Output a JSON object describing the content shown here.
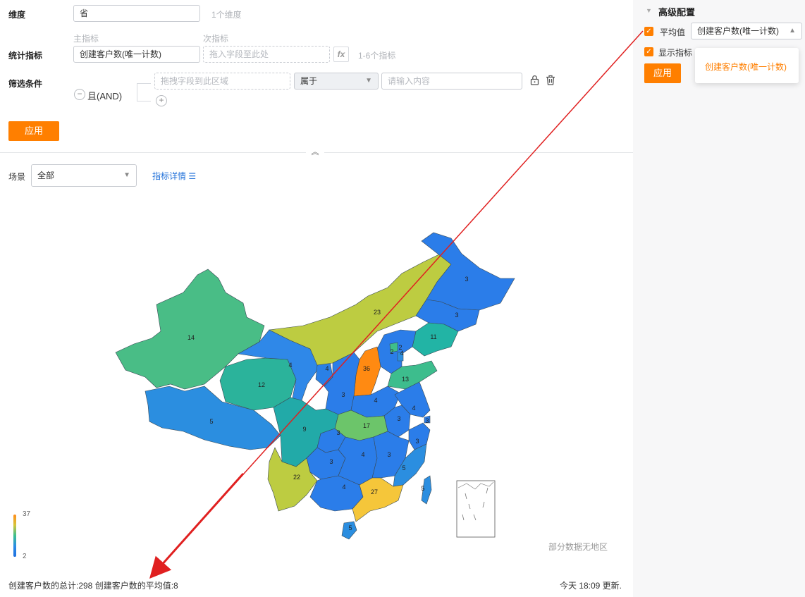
{
  "form": {
    "dimension_label": "维度",
    "dimension_value": "省",
    "dimension_hint": "1个维度",
    "main_metric_caption": "主指标",
    "secondary_metric_caption": "次指标",
    "metric_label": "统计指标",
    "main_metric_value": "创建客户数(唯一计数)",
    "secondary_metric_placeholder": "拖入字段至此处",
    "fx_label": "fx",
    "metric_hint": "1-6个指标",
    "filter_label": "筛选条件",
    "filter_drag_placeholder": "拖拽字段到此区域",
    "filter_operator": "属于",
    "filter_value_placeholder": "请输入内容",
    "and_label": "且(AND)",
    "apply_label": "应用"
  },
  "scene": {
    "label": "场景",
    "value": "全部",
    "detail_link": "指标详情"
  },
  "legend": {
    "max": "37",
    "min": "2"
  },
  "map_labels": [
    {
      "name": "xinjiang",
      "value": "14"
    },
    {
      "name": "tibet",
      "value": "5"
    },
    {
      "name": "qinghai",
      "value": "12"
    },
    {
      "name": "gansu",
      "value": "4"
    },
    {
      "name": "ningxia",
      "value": "4"
    },
    {
      "name": "neimenggu",
      "value": "23"
    },
    {
      "name": "heilongjiang",
      "value": "3"
    },
    {
      "name": "jilin",
      "value": "3"
    },
    {
      "name": "liaoning",
      "value": "11"
    },
    {
      "name": "shanxi",
      "value": "36"
    },
    {
      "name": "hebei",
      "value": "2"
    },
    {
      "name": "beijing",
      "value": "2"
    },
    {
      "name": "tianjin",
      "value": "4"
    },
    {
      "name": "shandong",
      "value": "13"
    },
    {
      "name": "henan",
      "value": "4"
    },
    {
      "name": "shaanxi",
      "value": "3"
    },
    {
      "name": "sichuan",
      "value": "9"
    },
    {
      "name": "chongqing",
      "value": "3"
    },
    {
      "name": "hubei",
      "value": "17"
    },
    {
      "name": "anhui",
      "value": "3"
    },
    {
      "name": "jiangsu",
      "value": "4"
    },
    {
      "name": "shanghai",
      "value": "3"
    },
    {
      "name": "zhejiang",
      "value": "3"
    },
    {
      "name": "hunan",
      "value": "4"
    },
    {
      "name": "jiangxi",
      "value": "3"
    },
    {
      "name": "fujian",
      "value": "5"
    },
    {
      "name": "guizhou",
      "value": "3"
    },
    {
      "name": "yunnan",
      "value": "22"
    },
    {
      "name": "guangxi",
      "value": "4"
    },
    {
      "name": "guangdong",
      "value": "27"
    },
    {
      "name": "taiwan",
      "value": "5"
    },
    {
      "name": "hainan",
      "value": "5"
    }
  ],
  "no_region_text": "部分数据无地区",
  "footer": {
    "summary": "创建客户数的总计:298   创建客户数的平均值:8",
    "updated": "今天 18:09 更新."
  },
  "advanced": {
    "title": "高级配置",
    "avg_label": "平均值",
    "avg_select": "创建客户数(唯一计数)",
    "show_label": "显示指标",
    "apply_label": "应用",
    "dropdown_option": "创建客户数(唯一计数)"
  },
  "colors": {
    "accent": "#ff7f00",
    "link": "#1e6fd9",
    "map_low": "#2b7de9",
    "map_mid": "#3dbf90",
    "map_high": "#ff8c1a",
    "annotation_arrow": "#e02020"
  }
}
